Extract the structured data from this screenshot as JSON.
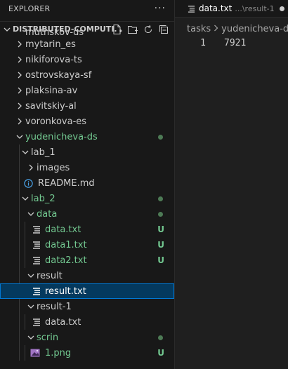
{
  "explorer": {
    "title": "EXPLORER",
    "more": "···"
  },
  "workspace": {
    "title": "DISTRIBUTED-COMPUTI..."
  },
  "tree": {
    "partial_item": "mutnskov-ds",
    "items": [
      {
        "label": "mytarin_es"
      },
      {
        "label": "nikiforova-ts"
      },
      {
        "label": "ostrovskaya-sf"
      },
      {
        "label": "plaksina-av"
      },
      {
        "label": "savitskiy-al"
      },
      {
        "label": "voronkova-es"
      },
      {
        "label": "yudenicheva-ds"
      },
      {
        "label": "lab_1"
      },
      {
        "label": "images"
      },
      {
        "label": "README.md"
      },
      {
        "label": "lab_2"
      },
      {
        "label": "data"
      },
      {
        "label": "data.txt",
        "status": "U"
      },
      {
        "label": "data1.txt",
        "status": "U"
      },
      {
        "label": "data2.txt",
        "status": "U"
      },
      {
        "label": "result"
      },
      {
        "label": "result.txt"
      },
      {
        "label": "result-1"
      },
      {
        "label": "data.txt"
      },
      {
        "label": "scrin"
      },
      {
        "label": "1.png",
        "status": "U"
      }
    ]
  },
  "editor": {
    "tab": {
      "label": "data.txt",
      "path": "...\\result-1"
    },
    "breadcrumbs": [
      "tasks",
      "yudenicheva-ds"
    ],
    "lines": [
      {
        "number": "1",
        "text": "7921"
      }
    ]
  },
  "colors": {
    "accent": "#0078d4",
    "untracked": "#73c991",
    "selection": "#04395e"
  }
}
